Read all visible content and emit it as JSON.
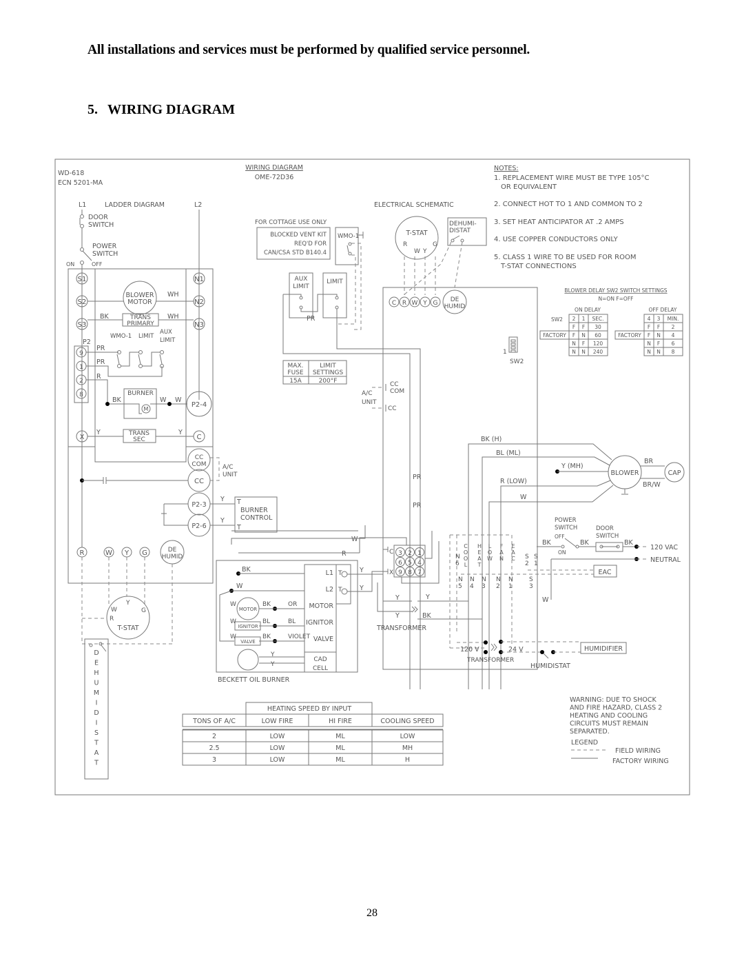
{
  "header": {
    "warning": "All installations and services must be performed by qualified service personnel.",
    "section_number": "5.",
    "section_title": "WIRING DIAGRAM"
  },
  "diagram": {
    "doc_id": "WD-618",
    "ecn": "ECN 5201-MA",
    "title": "WIRING DIAGRAM",
    "model": "OME-72D36",
    "ladder": {
      "title": "LADDER DIAGRAM",
      "l1": "L1",
      "l2": "L2",
      "door_switch": [
        "DOOR",
        "SWITCH"
      ],
      "power_switch": [
        "POWER",
        "SWITCH"
      ],
      "on": "ON",
      "off": "OFF",
      "terminals_left": [
        "S1",
        "S2",
        "S3"
      ],
      "terminals_right": [
        "N1",
        "N2",
        "N3"
      ],
      "blower_motor": [
        "BLOWER",
        "MOTOR"
      ],
      "trans_primary": [
        "TRANS",
        "PRIMARY"
      ],
      "wire_wh": "WH",
      "wire_bk": "BK",
      "wire_pr": "PR",
      "wire_r": "R",
      "wire_w": "W",
      "wire_y": "Y",
      "p2": "P2",
      "p2_pins": [
        "9",
        "1",
        "2",
        "8"
      ],
      "wmo": "WMO-1",
      "limit": "LIMIT",
      "aux_limit": [
        "AUX",
        "LIMIT"
      ],
      "burner": "BURNER",
      "motor_m": "M",
      "p2_4": "P2-4",
      "x": "X",
      "c": "C",
      "trans_sec": [
        "TRANS",
        "SEC"
      ],
      "cc_com": [
        "CC",
        "COM"
      ],
      "cc": "CC",
      "ac_unit": [
        "A/C",
        "UNIT"
      ],
      "p2_3": "P2-3",
      "p2_6": "P2-6",
      "burner_control": [
        "BURNER",
        "CONTROL"
      ],
      "t": "T",
      "tstat_terms": [
        "R",
        "W",
        "Y",
        "G"
      ],
      "dehumid": [
        "DE",
        "HUMID"
      ],
      "tstat": "T-STAT",
      "dehumidistat": "DEHUMIDISTAT"
    },
    "cottage": {
      "label": "FOR COTTAGE USE ONLY",
      "box": [
        "BLOCKED VENT KIT",
        "REQ'D FOR",
        "CAN/CSA STD B140.4"
      ],
      "wmo": "WMO-1"
    },
    "limits": {
      "aux_limit": [
        "AUX",
        "LIMIT"
      ],
      "limit": "LIMIT",
      "pr": "PR",
      "table_headers": [
        [
          "MAX.",
          "FUSE"
        ],
        [
          "LIMIT",
          "SETTINGS"
        ]
      ],
      "table_values": [
        "15A",
        "200°F"
      ]
    },
    "schematic": {
      "title": "ELECTRICAL SCHEMATIC",
      "tstat": "T-STAT",
      "tstat_terms": [
        "R",
        "W",
        "Y",
        "G"
      ],
      "dehumidistat": [
        "DEHUMI-",
        "DISTAT"
      ],
      "board_terms": [
        "C",
        "R",
        "W",
        "Y",
        "G"
      ],
      "de_humid": [
        "DE",
        "HUMID"
      ],
      "sw2": "SW2",
      "sw2_num": "1",
      "ac_unit": [
        "A/C",
        "UNIT"
      ],
      "cc_com": [
        "CC",
        "COM"
      ],
      "cc": "CC",
      "blower_wires": [
        "BK (H)",
        "BL (ML)",
        "Y (MH)",
        "R (LOW)",
        "W"
      ],
      "blower": "BLOWER",
      "cap": "CAP",
      "br": "BR",
      "brw": "BR/W",
      "pr": "PR",
      "plug_pins": [
        [
          "3",
          "2",
          "1"
        ],
        [
          "6",
          "5",
          "4"
        ],
        [
          "9",
          "8",
          "7"
        ]
      ],
      "ic": "C",
      "ix": "X",
      "board_top": [
        [
          "C",
          "O",
          "O",
          "L"
        ],
        [
          "H",
          "E",
          "A",
          "T"
        ],
        [
          "L",
          "O",
          "W"
        ],
        [
          "F",
          "A",
          "N"
        ],
        [
          "E",
          "A",
          "C"
        ]
      ],
      "s2": "S2",
      "s1": "S1",
      "n6": "N6",
      "board_bottom": [
        "N5",
        "N4",
        "N3",
        "N2",
        "N1",
        "S3"
      ],
      "power_switch": [
        "POWER",
        "SWITCH"
      ],
      "off": "OFF",
      "on": "ON",
      "door_switch": [
        "DOOR",
        "SWITCH"
      ],
      "bk": "BK",
      "vac": "120 VAC",
      "neutral": "NEUTRAL",
      "eac": "EAC",
      "wire_w": "W",
      "wire_r": "R",
      "wire_y": "Y",
      "transformer": "TRANSFORMER",
      "humid_transformer": "TRANSFORMER",
      "v120": "120 V",
      "v24": "24 V",
      "humidifier": "HUMIDIFIER",
      "humidistat": "HUMIDISTAT"
    },
    "burner": {
      "title": "BECKETT OIL BURNER",
      "bk": "BK",
      "w": "W",
      "components": [
        "MOTOR",
        "IGNITOR",
        "VALVE"
      ],
      "comp_wires": [
        "BK",
        "BL",
        "BK"
      ],
      "term_wires": [
        "OR",
        "BL",
        "VIOLET"
      ],
      "terminals": [
        "L1",
        "L2",
        "MOTOR",
        "IGNITOR",
        "VALVE"
      ],
      "cad_cell": [
        "CAD",
        "CELL"
      ],
      "t": "T",
      "y": "Y"
    },
    "notes": {
      "title": "NOTES:",
      "items": [
        [
          "1. REPLACEMENT WIRE MUST BE TYPE 105°C",
          "OR EQUIVALENT"
        ],
        [
          "2. CONNECT HOT TO 1 AND COMMON TO 2"
        ],
        [
          "3. SET HEAT ANTICIPATOR AT .2 AMPS"
        ],
        [
          "4. USE COPPER CONDUCTORS ONLY"
        ],
        [
          "5. CLASS 1 WIRE TO BE USED FOR ROOM",
          "T-STAT CONNECTIONS"
        ]
      ]
    },
    "blower_delay": {
      "title": "BLOWER DELAY SW2 SWITCH SETTINGS",
      "subtitle": "N=ON F=OFF",
      "on_delay": {
        "title": "ON DELAY",
        "label": "SW2",
        "headers": [
          "2",
          "1",
          "SEC."
        ],
        "rows": [
          [
            "F",
            "F",
            "30"
          ],
          [
            "F",
            "N",
            "60"
          ],
          [
            "N",
            "F",
            "120"
          ],
          [
            "N",
            "N",
            "240"
          ]
        ],
        "factory_row": 1
      },
      "off_delay": {
        "title": "OFF DELAY",
        "headers": [
          "4",
          "3",
          "MIN."
        ],
        "rows": [
          [
            "F",
            "F",
            "2"
          ],
          [
            "F",
            "N",
            "4"
          ],
          [
            "N",
            "F",
            "6"
          ],
          [
            "N",
            "N",
            "8"
          ]
        ],
        "factory_row": 1
      },
      "factory_label": "FACTORY"
    },
    "speed_table": {
      "group_header": "HEATING SPEED BY INPUT",
      "headers": [
        "TONS OF A/C",
        "LOW FIRE",
        "HI FIRE",
        "COOLING SPEED"
      ],
      "rows": [
        [
          "2",
          "LOW",
          "ML",
          "LOW"
        ],
        [
          "2.5",
          "LOW",
          "ML",
          "MH"
        ],
        [
          "3",
          "LOW",
          "ML",
          "H"
        ]
      ]
    },
    "warning": [
      "WARNING: DUE TO SHOCK",
      "AND FIRE HAZARD, CLASS 2",
      "HEATING AND COOLING",
      "CIRCUITS MUST REMAIN",
      "SEPARATED."
    ],
    "legend": {
      "title": "LEGEND",
      "field": "FIELD WIRING",
      "factory": "FACTORY WIRING"
    }
  },
  "page_number": "28"
}
